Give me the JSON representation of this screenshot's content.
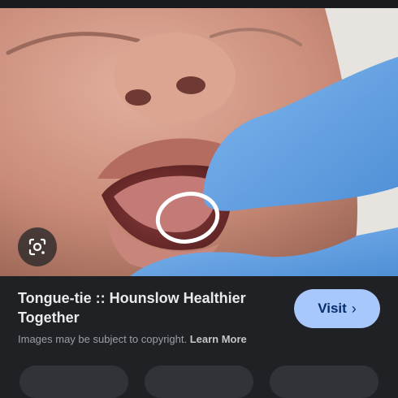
{
  "result": {
    "title": "Tongue-tie :: Hounslow Healthier Together",
    "copyright_text": "Images may be subject to copyright. ",
    "learn_more_label": "Learn More",
    "visit_label": "Visit",
    "visit_chevron": "›"
  },
  "icons": {
    "lens": "google-lens-icon",
    "chevron": "chevron-right-icon"
  },
  "colors": {
    "background": "#1f2125",
    "visit_button": "#a8c7fa",
    "glove": "#6aa8e8",
    "circle_annotation": "#ffffff"
  }
}
